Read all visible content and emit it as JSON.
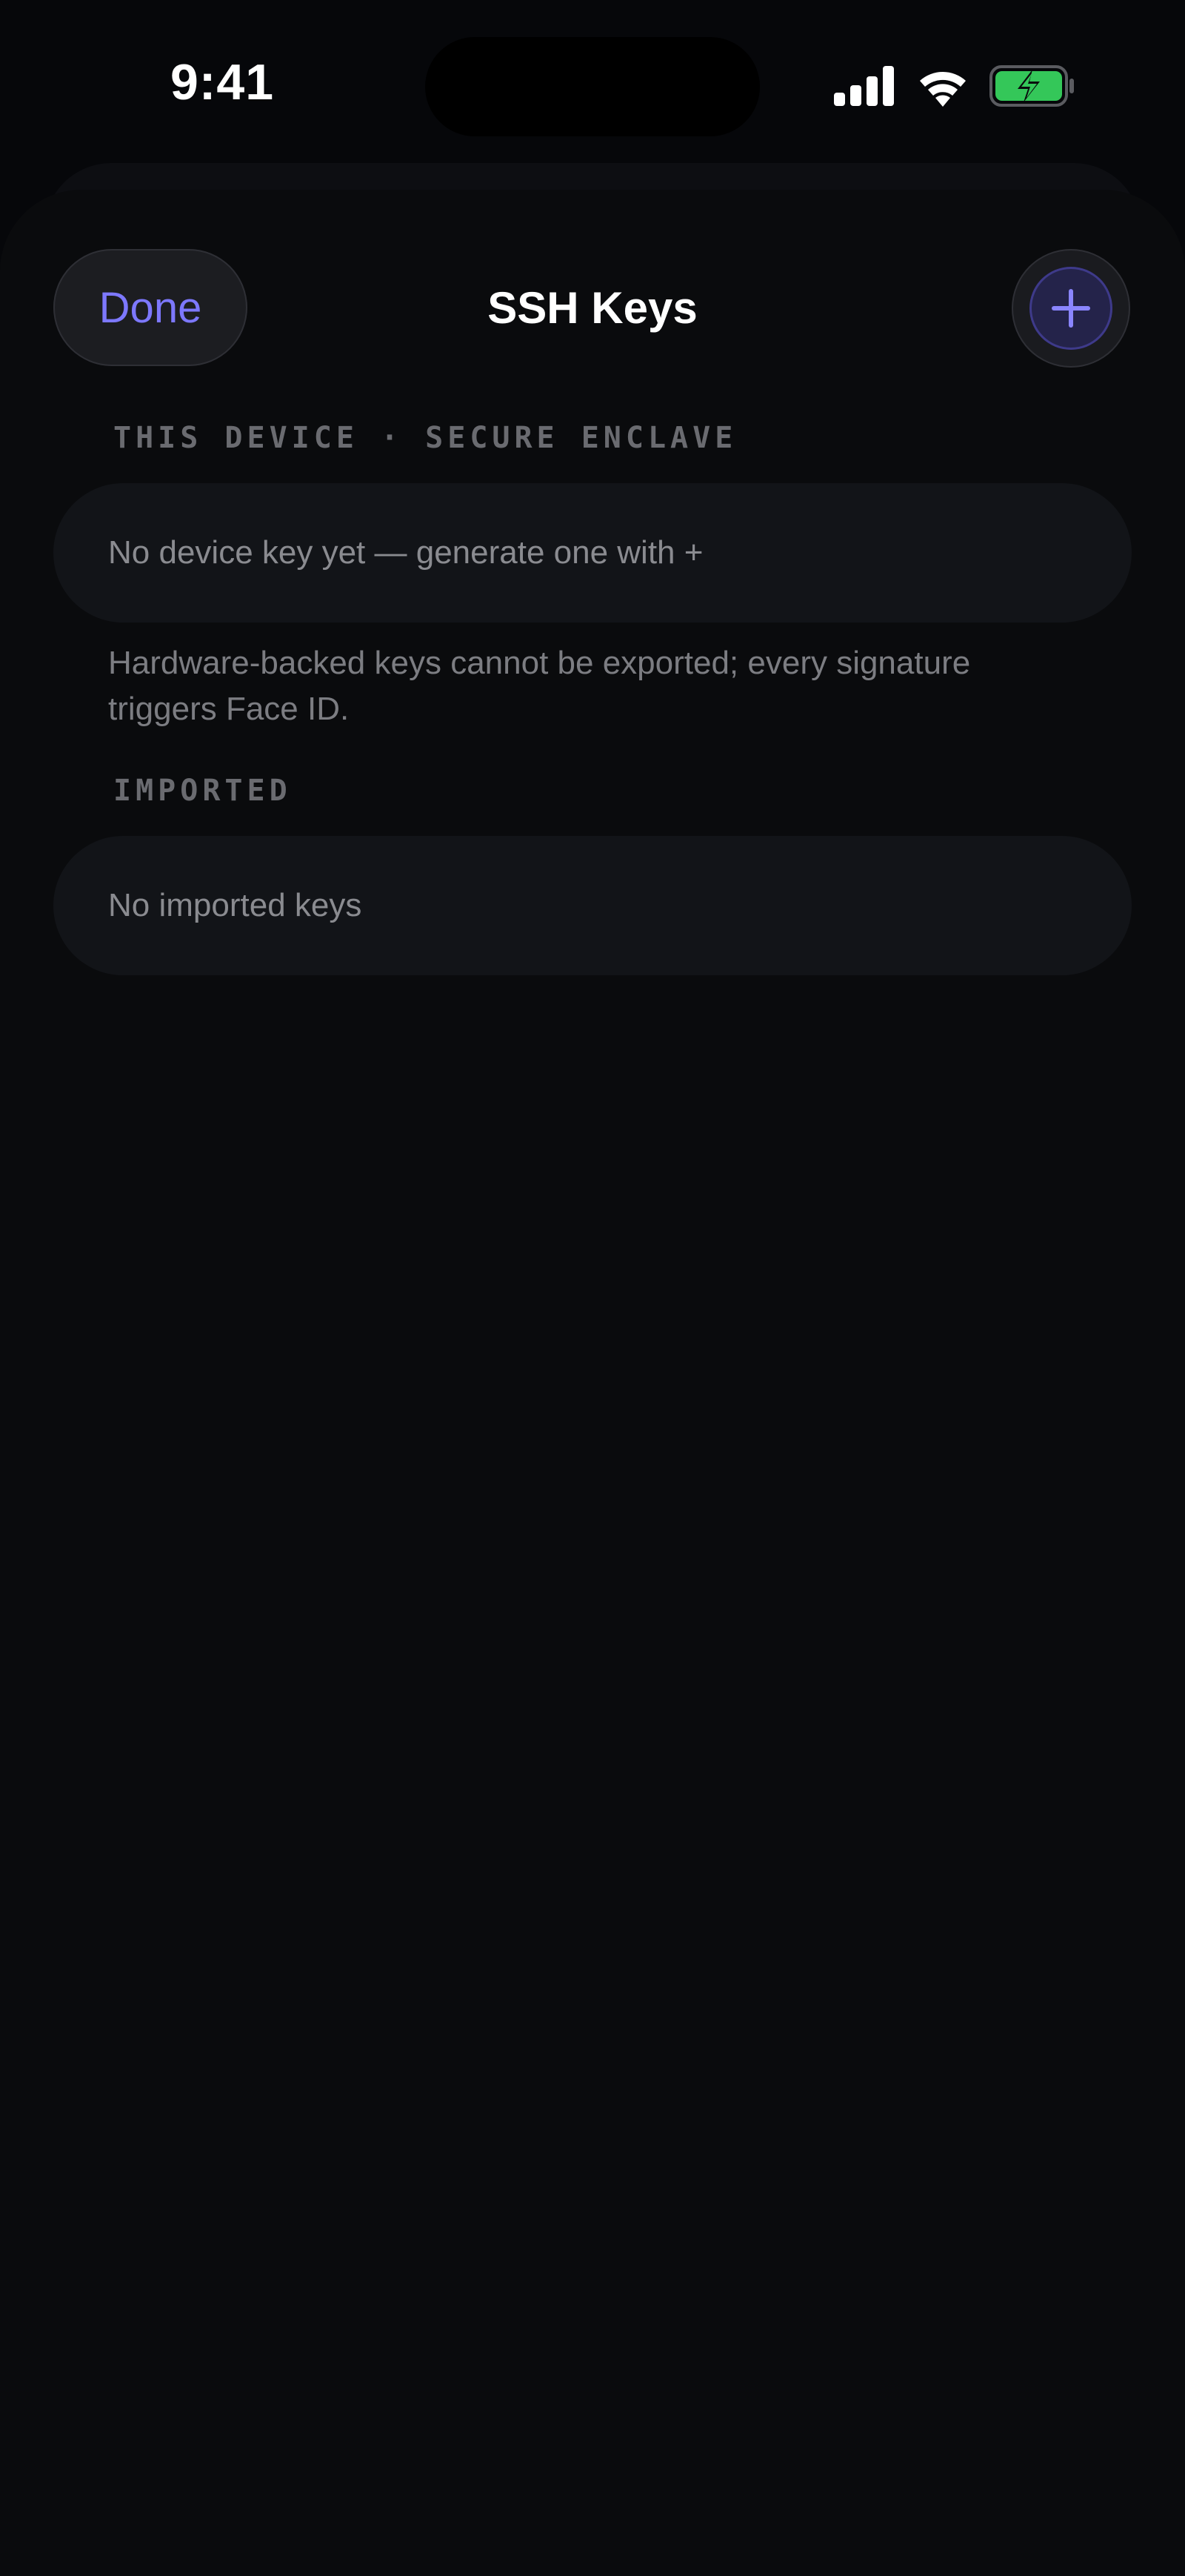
{
  "status_bar": {
    "time": "9:41",
    "icons": [
      "cellular-signal-icon",
      "wifi-icon",
      "battery-charging-icon"
    ],
    "battery_color": "#34c759"
  },
  "nav": {
    "done_label": "Done",
    "title": "SSH Keys",
    "add_icon": "plus-icon"
  },
  "sections": {
    "device": {
      "header": "THIS DEVICE · SECURE ENCLAVE",
      "empty_text": "No device key yet — generate one with +",
      "footnote": "Hardware-backed keys cannot be exported; every signature triggers Face ID."
    },
    "imported": {
      "header": "IMPORTED",
      "empty_text": "No imported keys"
    }
  },
  "colors": {
    "accent": "#7d78ff",
    "background": "#0a0b0d",
    "card": "#121418"
  }
}
